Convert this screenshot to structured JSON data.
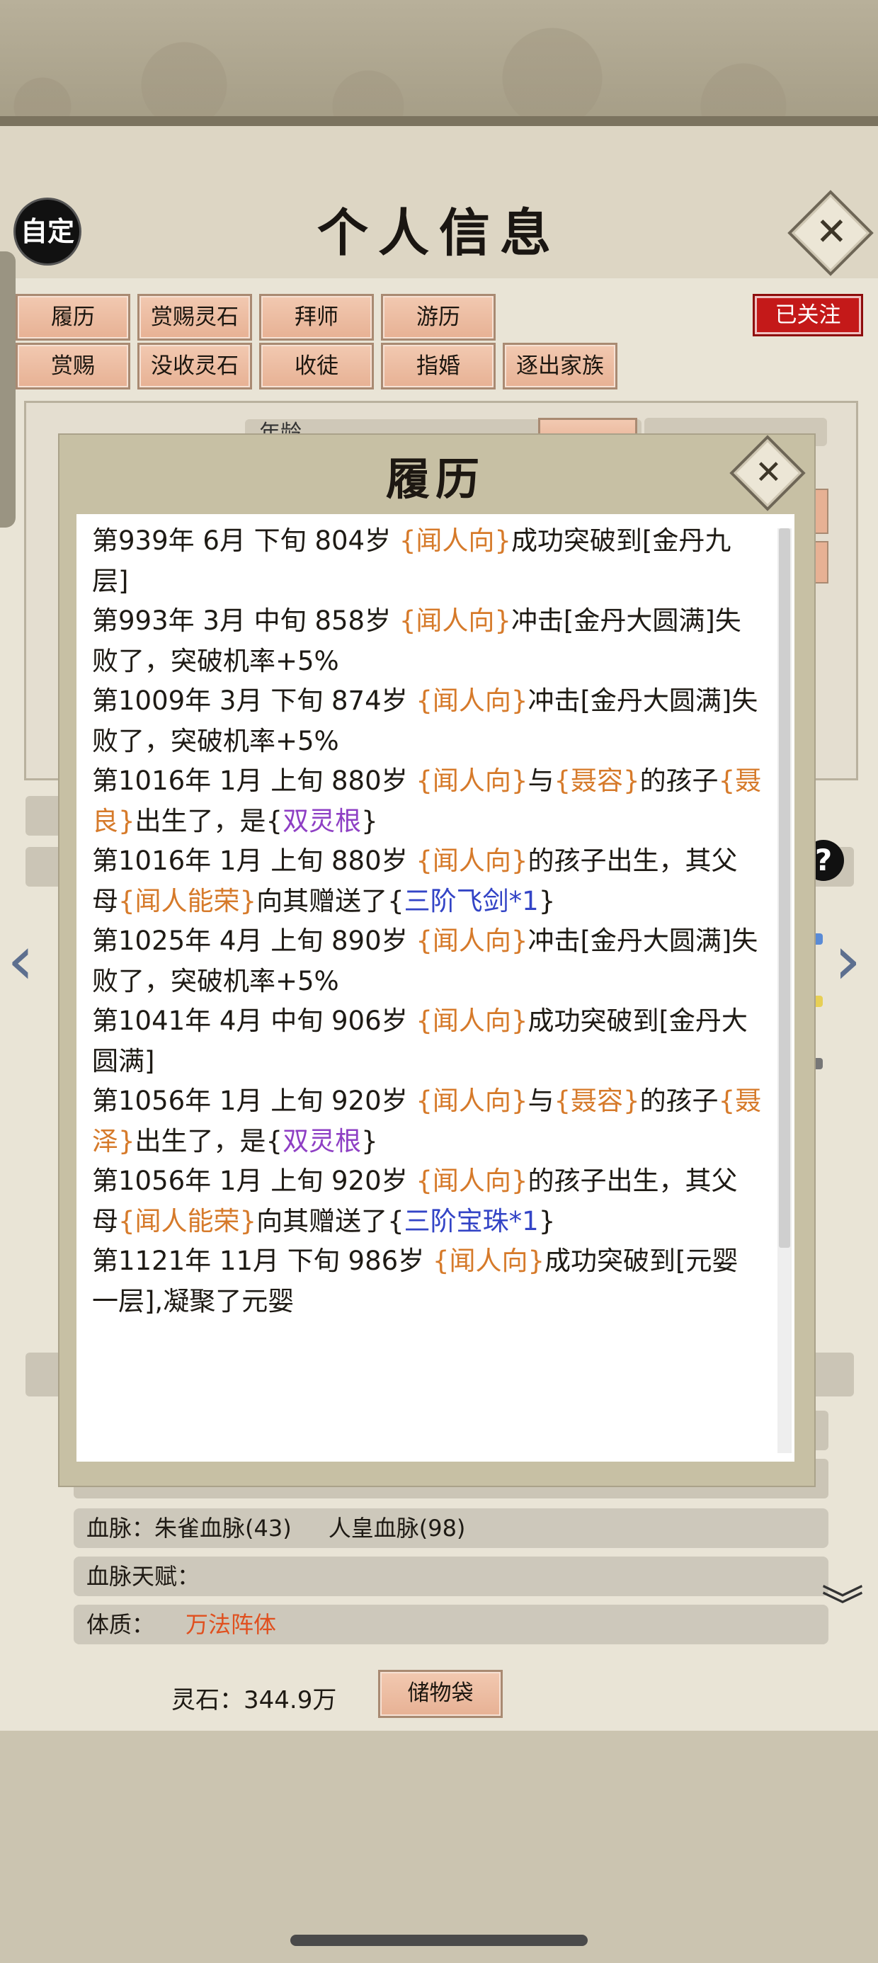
{
  "header": {
    "title": "个人信息",
    "custom_label": "自定",
    "follow_label": "已关注"
  },
  "actions": {
    "row1": [
      "履历",
      "赏赐灵石",
      "拜师",
      "游历"
    ],
    "row2": [
      "赏赐",
      "没收灵石",
      "收徒",
      "指婚",
      "逐出家族"
    ]
  },
  "partial_age_text": "年龄",
  "bloodline": {
    "label": "血脉：",
    "value1": "朱雀血脉(43)",
    "value2": "人皇血脉(98)"
  },
  "bloodline_talent": {
    "label": "血脉天赋："
  },
  "physique": {
    "label": "体质：",
    "value": "万法阵体"
  },
  "lingshi": {
    "text": "灵石：344.9万"
  },
  "bag_button": "储物袋",
  "modal": {
    "title": "履历",
    "entries": [
      [
        [
          "第939年 6月 下旬  804岁 ",
          ""
        ],
        [
          "{闻人向}",
          "o"
        ],
        [
          "成功突破到[金丹九层]",
          ""
        ]
      ],
      [
        [
          "第993年 3月 中旬  858岁 ",
          ""
        ],
        [
          "{闻人向}",
          "o"
        ],
        [
          "冲击[金丹大圆满]失败了，突破机率+5%",
          ""
        ]
      ],
      [
        [
          "第1009年 3月 下旬  874岁 ",
          ""
        ],
        [
          "{闻人向}",
          "o"
        ],
        [
          "冲击[金丹大圆满]失败了，突破机率+5%",
          ""
        ]
      ],
      [
        [
          "第1016年 1月 上旬  880岁 ",
          ""
        ],
        [
          "{闻人向}",
          "o"
        ],
        [
          "与",
          ""
        ],
        [
          "{聂容}",
          "o"
        ],
        [
          "的孩子",
          ""
        ],
        [
          "{聂良}",
          "o"
        ],
        [
          "出生了，是{",
          ""
        ],
        [
          "双灵根",
          "p"
        ],
        [
          "}",
          ""
        ]
      ],
      [
        [
          "第1016年 1月 上旬  880岁 ",
          ""
        ],
        [
          "{闻人向}",
          "o"
        ],
        [
          "的孩子出生，其父母",
          ""
        ],
        [
          "{闻人能荣}",
          "o"
        ],
        [
          "向其赠送了{",
          ""
        ],
        [
          "三阶飞剑*1",
          "b"
        ],
        [
          "}",
          ""
        ]
      ],
      [
        [
          "第1025年 4月 上旬 890岁 ",
          ""
        ],
        [
          "{闻人向}",
          "o"
        ],
        [
          "冲击[金丹大圆满]失败了，突破机率+5%",
          ""
        ]
      ],
      [
        [
          "第1041年 4月 中旬  906岁 ",
          ""
        ],
        [
          "{闻人向}",
          "o"
        ],
        [
          "成功突破到[金丹大圆满]",
          ""
        ]
      ],
      [
        [
          "第1056年 1月 上旬  920岁 ",
          ""
        ],
        [
          "{闻人向}",
          "o"
        ],
        [
          "与",
          ""
        ],
        [
          "{聂容}",
          "o"
        ],
        [
          "的孩子",
          ""
        ],
        [
          "{聂泽}",
          "o"
        ],
        [
          "出生了，是{",
          ""
        ],
        [
          "双灵根",
          "p"
        ],
        [
          "}",
          ""
        ]
      ],
      [
        [
          "第1056年 1月 上旬  920岁 ",
          ""
        ],
        [
          "{闻人向}",
          "o"
        ],
        [
          "的孩子出生，其父母",
          ""
        ],
        [
          "{闻人能荣}",
          "o"
        ],
        [
          "向其赠送了{",
          ""
        ],
        [
          "三阶宝珠*1",
          "b"
        ],
        [
          "}",
          ""
        ]
      ],
      [
        [
          "第1121年 11月 下旬  986岁 ",
          ""
        ],
        [
          "{闻人向}",
          "o"
        ],
        [
          "成功突破到[元婴一层],凝聚了元婴",
          ""
        ]
      ]
    ]
  },
  "icons": {
    "close": "close-icon",
    "help": "help-icon",
    "left": "left-arrow-icon",
    "right": "right-arrow-icon",
    "expand": "double-chevron-down-icon"
  },
  "colors": {
    "name_orange": "#d67a2a",
    "item_blue": "#3344c6",
    "root_purple": "#8e3fc4",
    "follow_red": "#c41919"
  }
}
